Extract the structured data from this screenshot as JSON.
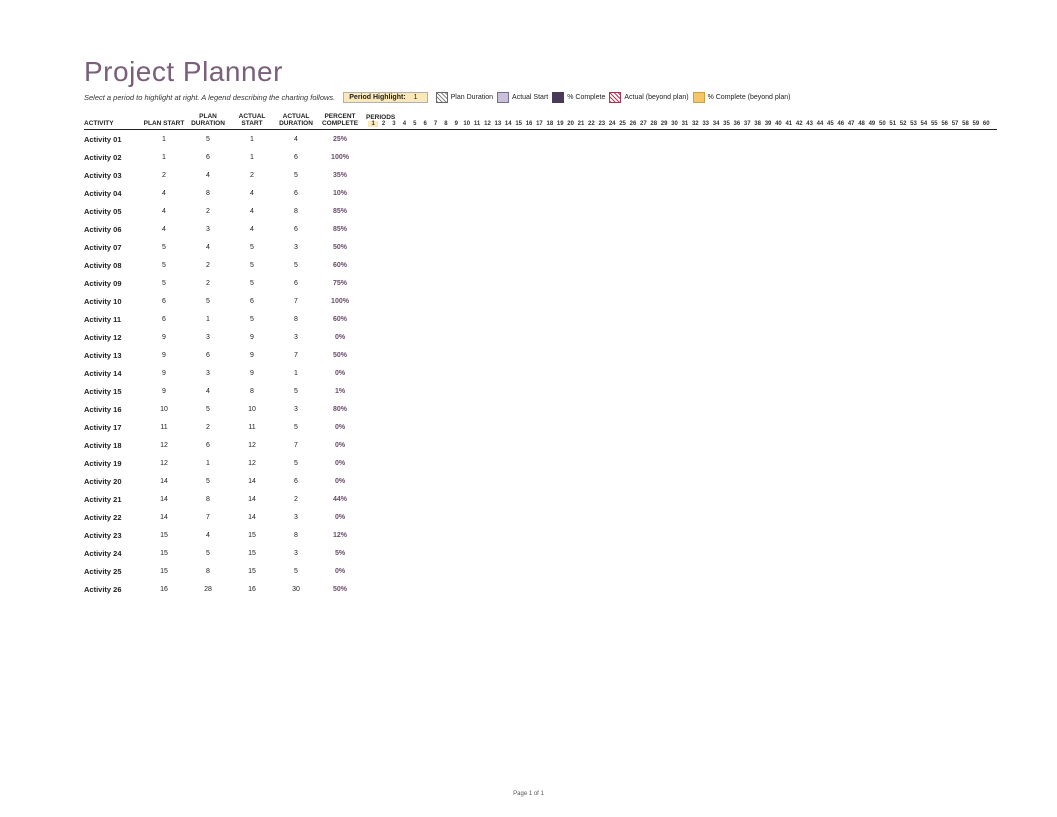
{
  "title": "Project Planner",
  "hint": "Select a period to highlight at right. A legend describing the charting follows.",
  "highlight": {
    "label": "Period Highlight:",
    "value": "1"
  },
  "legend": [
    {
      "label": "Plan Duration",
      "sw": "hatch"
    },
    {
      "label": "Actual Start",
      "sw": "solid-lav"
    },
    {
      "label": "% Complete",
      "sw": "solid-dark"
    },
    {
      "label": "Actual (beyond plan)",
      "sw": "hatch-red"
    },
    {
      "label": "% Complete (beyond plan)",
      "sw": "solid-ora"
    }
  ],
  "columns": {
    "activity": "ACTIVITY",
    "plan_start": "PLAN START",
    "plan_dur": "PLAN\nDURATION",
    "act_start": "ACTUAL\nSTART",
    "act_dur": "ACTUAL\nDURATION",
    "pct": "PERCENT\nCOMPLETE",
    "periods": "PERIODS"
  },
  "periods_count": 60,
  "rows": [
    {
      "a": "Activity 01",
      "ps": "1",
      "pd": "5",
      "as": "1",
      "ad": "4",
      "pc": "25%"
    },
    {
      "a": "Activity 02",
      "ps": "1",
      "pd": "6",
      "as": "1",
      "ad": "6",
      "pc": "100%"
    },
    {
      "a": "Activity 03",
      "ps": "2",
      "pd": "4",
      "as": "2",
      "ad": "5",
      "pc": "35%"
    },
    {
      "a": "Activity 04",
      "ps": "4",
      "pd": "8",
      "as": "4",
      "ad": "6",
      "pc": "10%"
    },
    {
      "a": "Activity 05",
      "ps": "4",
      "pd": "2",
      "as": "4",
      "ad": "8",
      "pc": "85%"
    },
    {
      "a": "Activity 06",
      "ps": "4",
      "pd": "3",
      "as": "4",
      "ad": "6",
      "pc": "85%"
    },
    {
      "a": "Activity 07",
      "ps": "5",
      "pd": "4",
      "as": "5",
      "ad": "3",
      "pc": "50%"
    },
    {
      "a": "Activity 08",
      "ps": "5",
      "pd": "2",
      "as": "5",
      "ad": "5",
      "pc": "60%"
    },
    {
      "a": "Activity 09",
      "ps": "5",
      "pd": "2",
      "as": "5",
      "ad": "6",
      "pc": "75%"
    },
    {
      "a": "Activity 10",
      "ps": "6",
      "pd": "5",
      "as": "6",
      "ad": "7",
      "pc": "100%"
    },
    {
      "a": "Activity 11",
      "ps": "6",
      "pd": "1",
      "as": "5",
      "ad": "8",
      "pc": "60%"
    },
    {
      "a": "Activity 12",
      "ps": "9",
      "pd": "3",
      "as": "9",
      "ad": "3",
      "pc": "0%"
    },
    {
      "a": "Activity 13",
      "ps": "9",
      "pd": "6",
      "as": "9",
      "ad": "7",
      "pc": "50%"
    },
    {
      "a": "Activity 14",
      "ps": "9",
      "pd": "3",
      "as": "9",
      "ad": "1",
      "pc": "0%"
    },
    {
      "a": "Activity 15",
      "ps": "9",
      "pd": "4",
      "as": "8",
      "ad": "5",
      "pc": "1%"
    },
    {
      "a": "Activity 16",
      "ps": "10",
      "pd": "5",
      "as": "10",
      "ad": "3",
      "pc": "80%"
    },
    {
      "a": "Activity 17",
      "ps": "11",
      "pd": "2",
      "as": "11",
      "ad": "5",
      "pc": "0%"
    },
    {
      "a": "Activity 18",
      "ps": "12",
      "pd": "6",
      "as": "12",
      "ad": "7",
      "pc": "0%"
    },
    {
      "a": "Activity 19",
      "ps": "12",
      "pd": "1",
      "as": "12",
      "ad": "5",
      "pc": "0%"
    },
    {
      "a": "Activity 20",
      "ps": "14",
      "pd": "5",
      "as": "14",
      "ad": "6",
      "pc": "0%"
    },
    {
      "a": "Activity 21",
      "ps": "14",
      "pd": "8",
      "as": "14",
      "ad": "2",
      "pc": "44%"
    },
    {
      "a": "Activity 22",
      "ps": "14",
      "pd": "7",
      "as": "14",
      "ad": "3",
      "pc": "0%"
    },
    {
      "a": "Activity 23",
      "ps": "15",
      "pd": "4",
      "as": "15",
      "ad": "8",
      "pc": "12%"
    },
    {
      "a": "Activity 24",
      "ps": "15",
      "pd": "5",
      "as": "15",
      "ad": "3",
      "pc": "5%"
    },
    {
      "a": "Activity 25",
      "ps": "15",
      "pd": "8",
      "as": "15",
      "ad": "5",
      "pc": "0%"
    },
    {
      "a": "Activity 26",
      "ps": "16",
      "pd": "28",
      "as": "16",
      "ad": "30",
      "pc": "50%"
    }
  ],
  "footer": "Page 1 of 1"
}
